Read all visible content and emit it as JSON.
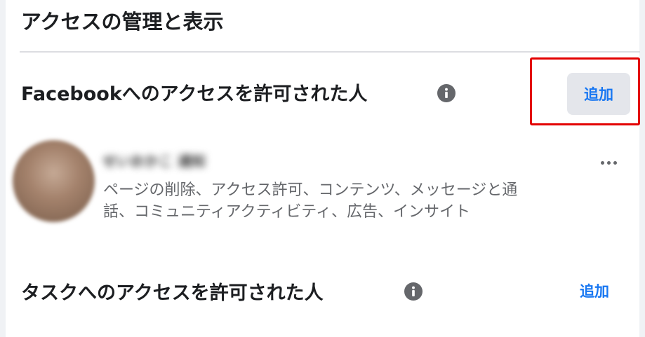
{
  "page_title": "アクセスの管理と表示",
  "facebook_access": {
    "title": "Facebookへのアクセスを許可された人",
    "info_icon": "info-circle-icon",
    "add_label": "追加",
    "people": [
      {
        "name": "せいおかこ 通知",
        "permissions_line1": "ページの削除、アクセス許可、コンテンツ、メッセージと通",
        "permissions_line2": "話、コミュニティアクティビティ、広告、インサイト",
        "more_icon": "more-horizontal-icon"
      }
    ]
  },
  "task_access": {
    "title": "タスクへのアクセスを許可された人",
    "info_icon": "info-circle-icon",
    "add_label": "追加"
  },
  "colors": {
    "accent": "#1877f2",
    "highlight": "#e30000",
    "secondary_text": "#65676b",
    "button_bg": "#e4e6eb"
  }
}
